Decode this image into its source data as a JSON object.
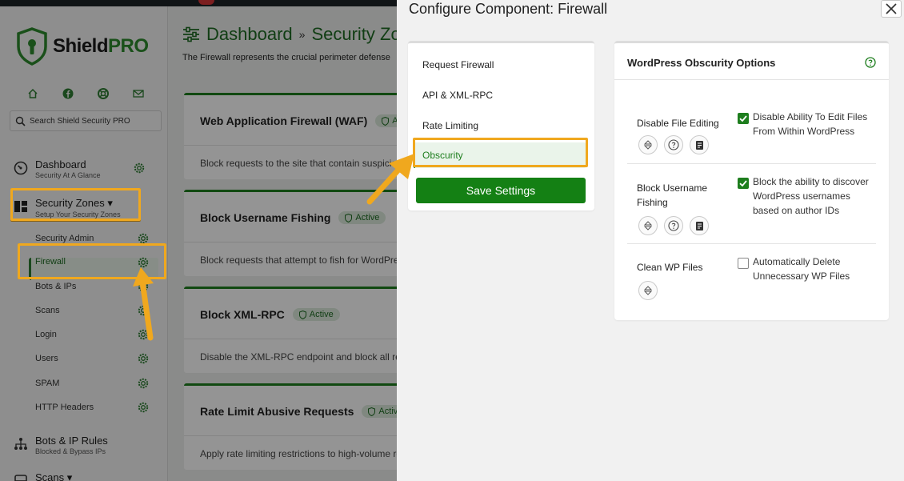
{
  "brand": {
    "name_main": "Shield",
    "name_accent": "PRO"
  },
  "sidebar": {
    "search_placeholder": "Search Shield Security PRO",
    "quick_icons": [
      "home-icon",
      "facebook-icon",
      "support-icon",
      "email-icon"
    ],
    "main_items": [
      {
        "title": "Dashboard",
        "subtitle": "Security At A Glance"
      },
      {
        "title": "Security Zones ▾",
        "subtitle": "Setup Your Security Zones"
      },
      {
        "title": "Bots & IP Rules",
        "subtitle": "Blocked & Bypass IPs"
      },
      {
        "title": "Scans ▾",
        "subtitle": ""
      }
    ],
    "sub_items": [
      "Security Admin",
      "Firewall",
      "Bots & IPs",
      "Scans",
      "Login",
      "Users",
      "SPAM",
      "HTTP Headers"
    ]
  },
  "main": {
    "breadcrumb_dashboard": "Dashboard",
    "breadcrumb_sep": "»",
    "breadcrumb_zones": "Security Zones",
    "description": "The Firewall represents the crucial perimeter defense",
    "cards": [
      {
        "title": "Web Application Firewall (WAF)",
        "badge": "Active",
        "desc": "Block requests to the site that contain suspicious data"
      },
      {
        "title": "Block Username Fishing",
        "badge": "Active",
        "desc": "Block requests that attempt to fish for WordPress usernames"
      },
      {
        "title": "Block XML-RPC",
        "badge": "Active",
        "desc": "Disable the XML-RPC endpoint and block all requests"
      },
      {
        "title": "Rate Limit Abusive Requests",
        "badge": "Active",
        "desc": "Apply rate limiting restrictions to high-volume requests"
      }
    ]
  },
  "panel": {
    "title": "Configure Component: Firewall",
    "tabs": [
      "Request Firewall",
      "API & XML-RPC",
      "Rate Limiting",
      "Obscurity"
    ],
    "active_tab": "Obscurity",
    "save_label": "Save Settings",
    "options_title": "WordPress Obscurity Options",
    "options": [
      {
        "label": "Disable File Editing",
        "checked": true,
        "text": "Disable Ability To Edit Files From Within WordPress"
      },
      {
        "label": "Block Username Fishing",
        "checked": true,
        "text": "Block the ability to discover WordPress usernames based on author IDs"
      },
      {
        "label": "Clean WP Files",
        "checked": false,
        "text": "Automatically Delete Unnecessary WP Files"
      }
    ]
  },
  "colors": {
    "accent": "#1e7e1e",
    "highlight": "#f0a81e",
    "badge_bg": "#dcebdc"
  }
}
